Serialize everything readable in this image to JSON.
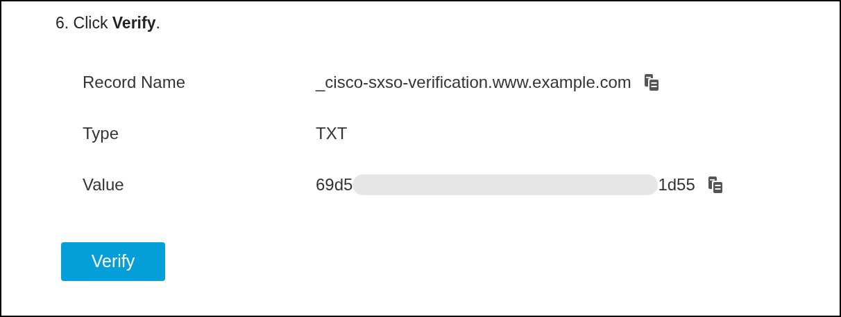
{
  "step": "6. Click **Verify**.",
  "fields": [
    {
      "label": "Record Name",
      "value": "_cisco-sxso-verification.www.example.com",
      "copyable": true,
      "redacted": false
    },
    {
      "label": "Type",
      "value": "TXT",
      "copyable": false,
      "redacted": false
    },
    {
      "label": "Value",
      "value_start": "69d5",
      "value_end": "1d55",
      "copyable": true,
      "redacted": true
    }
  ],
  "button": "Verify"
}
